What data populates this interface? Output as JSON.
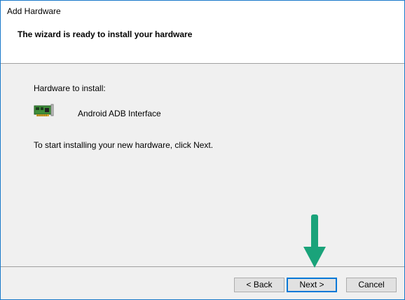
{
  "window": {
    "title": "Add Hardware"
  },
  "header": {
    "title": "The wizard is ready to install your hardware"
  },
  "content": {
    "hardware_label": "Hardware to install:",
    "hardware_name": "Android ADB Interface",
    "instruction": "To start installing your new hardware, click Next."
  },
  "buttons": {
    "back_label": "< Back",
    "next_label": "Next >",
    "cancel_label": "Cancel"
  },
  "annotation": {
    "arrow_icon": "down-arrow-icon",
    "arrow_color": "#1aa37a"
  },
  "colors": {
    "window_border": "#1979ca",
    "default_button_border": "#0078d7"
  }
}
